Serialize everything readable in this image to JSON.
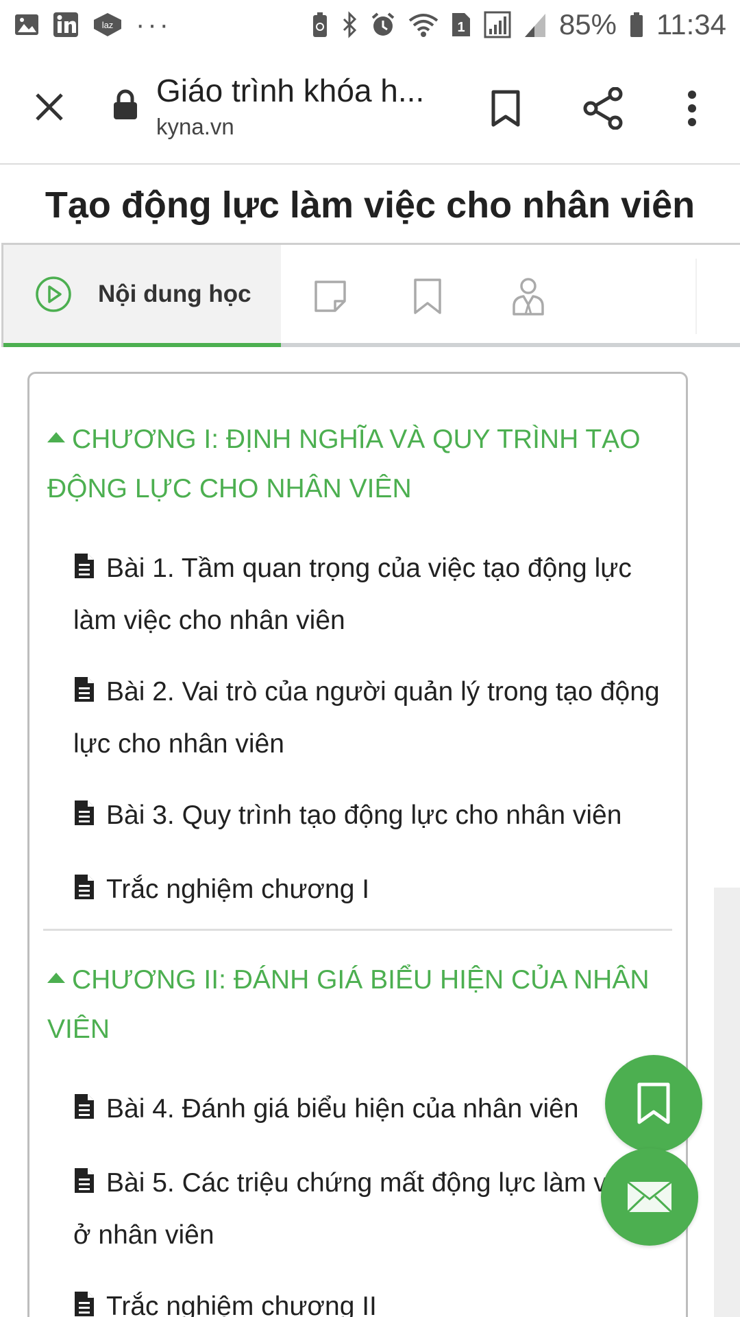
{
  "status_bar": {
    "battery": "85%",
    "time": "11:34",
    "sim_badge": "1",
    "laz_label": "laz",
    "overflow": "···",
    "icons": [
      "gallery-icon",
      "linkedin-icon",
      "lazada-icon",
      "more-dots-icon",
      "battery-saver-icon",
      "bluetooth-icon",
      "alarm-icon",
      "wifi-icon",
      "sim-1-icon",
      "signal-icon",
      "signal-2-icon",
      "battery-icon"
    ]
  },
  "browser": {
    "page_title": "Giáo trình khóa h...",
    "url": "kyna.vn",
    "icons": [
      "close-icon",
      "lock-icon",
      "bookmark-icon",
      "share-icon",
      "more-vert-icon"
    ]
  },
  "course": {
    "title": "Tạo động lực làm việc cho nhân viên"
  },
  "tabs": {
    "active_label": "Nội dung học",
    "icons": [
      "play-circle-icon",
      "note-icon",
      "bookmark-icon",
      "instructor-icon"
    ]
  },
  "content": {
    "chapter1": {
      "title": "CHƯƠNG I: ĐỊNH NGHĨA VÀ QUY TRÌNH TẠO ĐỘNG LỰC CHO NHÂN VIÊN",
      "lessons": [
        "Bài 1. Tầm quan trọng của việc tạo động lực làm việc cho nhân viên",
        "Bài 2. Vai trò của người quản lý trong tạo động lực cho nhân viên",
        "Bài 3. Quy trình tạo động lực cho nhân viên",
        "Trắc nghiệm chương I"
      ]
    },
    "chapter2": {
      "title": "CHƯƠNG II: ĐÁNH GIÁ BIỂU HIỆN CỦA NHÂN VIÊN",
      "lessons": [
        "Bài 4. Đánh giá biểu hiện của nhân viên",
        "Bài 5. Các triệu chứng mất động lực làm việc ở nhân viên",
        "Trắc nghiệm chương II"
      ]
    }
  },
  "colors": {
    "accent": "#4caf50",
    "text": "#212121",
    "border": "#bdbdbd"
  },
  "fabs": {
    "icons": [
      "bookmark-icon",
      "mail-icon"
    ]
  }
}
